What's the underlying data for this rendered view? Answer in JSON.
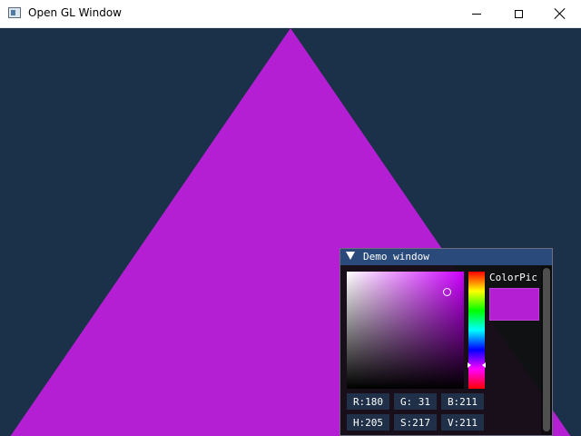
{
  "window": {
    "title": "Open GL Window",
    "icon": "opengl-app-icon",
    "controls": {
      "minimize": "minimize-icon",
      "maximize": "maximize-icon",
      "close": "close-icon"
    }
  },
  "scene": {
    "background_color": "#1b3049",
    "triangle_color": "#b41fd3"
  },
  "demo_window": {
    "title": "Demo window",
    "collapsed": false,
    "title_bar_color": "#294a7a",
    "color_picker": {
      "label": "ColorPic",
      "color": "#b41fd3",
      "saturation_fraction": 0.85,
      "value_fraction": 0.83,
      "hue_fraction": 0.8,
      "rgb": {
        "r": "R:180",
        "g": "G: 31",
        "b": "B:211"
      },
      "hsv": {
        "h": "H:205",
        "s": "S:217",
        "v": "V:211"
      }
    }
  }
}
